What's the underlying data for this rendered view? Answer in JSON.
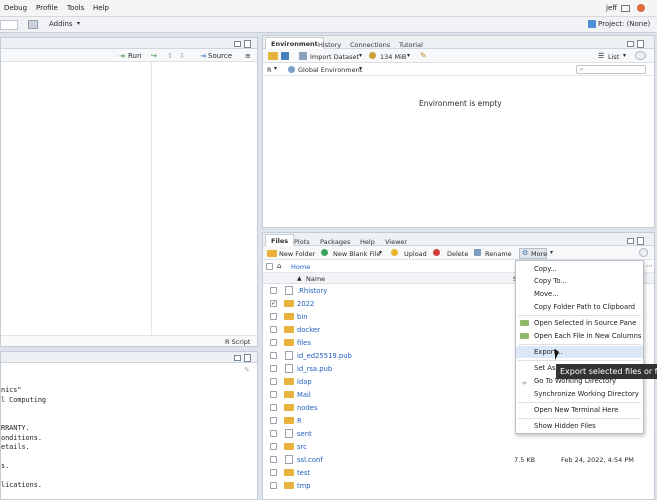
{
  "menubar": {
    "items": [
      "Debug",
      "Profile",
      "Tools",
      "Help"
    ],
    "user": "jeff"
  },
  "toolbar": {
    "addins": "Addins",
    "project": "Project: (None)"
  },
  "source_pane": {
    "run": "Run",
    "source": "Source",
    "script_type": "R Script"
  },
  "console_lines": [
    "nics\"",
    "l Computing",
    "",
    "",
    "RRANTY.",
    "onditions.",
    "etails.",
    "",
    "s.",
    "",
    "lications.",
    "",
    "f"
  ],
  "env_pane": {
    "tabs": [
      "Environment",
      "History",
      "Connections",
      "Tutorial"
    ],
    "import_dataset": "Import Dataset",
    "memory": "134 MiB",
    "list_label": "List",
    "language": "R",
    "scope": "Global Environment",
    "empty_message": "Environment is empty"
  },
  "files_pane": {
    "tabs": [
      "Files",
      "Plots",
      "Packages",
      "Help",
      "Viewer"
    ],
    "actions": {
      "new_folder": "New Folder",
      "new_blank_file": "New Blank File",
      "upload": "Upload",
      "delete": "Delete",
      "rename": "Rename",
      "more": "More"
    },
    "breadcrumb": "Home",
    "col_name": "Name",
    "col_size_partial": "S",
    "rows": [
      {
        "name": ".Rhistory",
        "kind": "file",
        "checked": false,
        "size": "",
        "modified": ""
      },
      {
        "name": "2022",
        "kind": "folder",
        "checked": true,
        "size": "",
        "modified": ""
      },
      {
        "name": "bin",
        "kind": "folder",
        "checked": false,
        "size": "",
        "modified": ""
      },
      {
        "name": "docker",
        "kind": "folder",
        "checked": false,
        "size": "",
        "modified": ""
      },
      {
        "name": "files",
        "kind": "folder",
        "checked": false,
        "size": "",
        "modified": ""
      },
      {
        "name": "id_ed25519.pub",
        "kind": "file",
        "checked": false,
        "size": "",
        "modified": ""
      },
      {
        "name": "id_rsa.pub",
        "kind": "file",
        "checked": false,
        "size": "",
        "modified": ""
      },
      {
        "name": "ldap",
        "kind": "folder",
        "checked": false,
        "size": "",
        "modified": ""
      },
      {
        "name": "Mail",
        "kind": "folder",
        "checked": false,
        "size": "",
        "modified": ""
      },
      {
        "name": "nodes",
        "kind": "folder",
        "checked": false,
        "size": "",
        "modified": ""
      },
      {
        "name": "R",
        "kind": "folder",
        "checked": false,
        "size": "",
        "modified": ""
      },
      {
        "name": "sent",
        "kind": "file",
        "checked": false,
        "size": "",
        "modified": ""
      },
      {
        "name": "src",
        "kind": "folder",
        "checked": false,
        "size": "",
        "modified": ""
      },
      {
        "name": "ssl.conf",
        "kind": "file",
        "checked": false,
        "size": "7.5 KB",
        "modified": "Feb 24, 2022, 4:54 PM"
      },
      {
        "name": "test",
        "kind": "folder",
        "checked": false,
        "size": "",
        "modified": ""
      },
      {
        "name": "tmp",
        "kind": "folder",
        "checked": false,
        "size": "",
        "modified": ""
      }
    ]
  },
  "context_menu": {
    "items": [
      "Copy...",
      "Copy To...",
      "Move...",
      "Copy Folder Path to Clipboard",
      "Open Selected in Source Pane",
      "Open Each File in New Columns",
      "Export...",
      "Set As Working Directory",
      "Go To Working Directory",
      "Synchronize Working Directory",
      "Open New Terminal Here",
      "Show Hidden Files"
    ],
    "highlighted_index": 6
  },
  "tooltip": "Export selected files or fo",
  "colors": {
    "accent": "#1f5fbf",
    "folder": "#e9b23a",
    "highlight": "#dbe8f7"
  }
}
